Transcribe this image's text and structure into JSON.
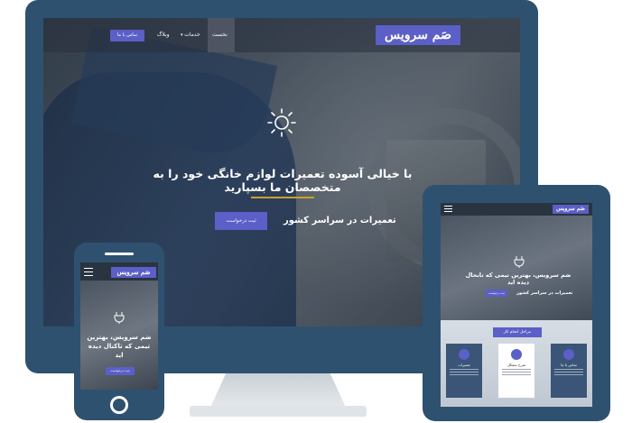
{
  "brand": {
    "logo_text": "صَم سرویس",
    "accent": "#5b5fc7",
    "device_frame": "#2f5170"
  },
  "monitor": {
    "nav": {
      "items": [
        "نخست",
        "خدمات",
        "وبلاگ"
      ],
      "dropdown_icon": "chevron-down-icon",
      "contact_button": "تماس با ما"
    },
    "hero": {
      "icon": "sun-icon",
      "title": "با خیالی آسوده تعمیرات لوازم خانگی خود را به متخصصان ما بسپارید",
      "cta": "ثبت درخواست",
      "subtitle": "تعمیرات در سراسر کشور"
    }
  },
  "tablet": {
    "hero": {
      "icon": "plug-icon",
      "title": "صَم سرویس، بهترین تیمی که تابحال دیده اید",
      "cta": "ثبت درخواست",
      "subtitle": "تعمیرات در سراسر کشور"
    },
    "steps": {
      "title": "مراحل انجام کار",
      "cards": [
        "تماس با ما",
        "شرح مشکل",
        "تعمیرات"
      ]
    }
  },
  "phone": {
    "hero": {
      "icon": "plug-icon",
      "title": "صَم سرویس، بهترین تیمی که تاکنال دیده اید",
      "cta": "ثبت درخواست"
    }
  }
}
